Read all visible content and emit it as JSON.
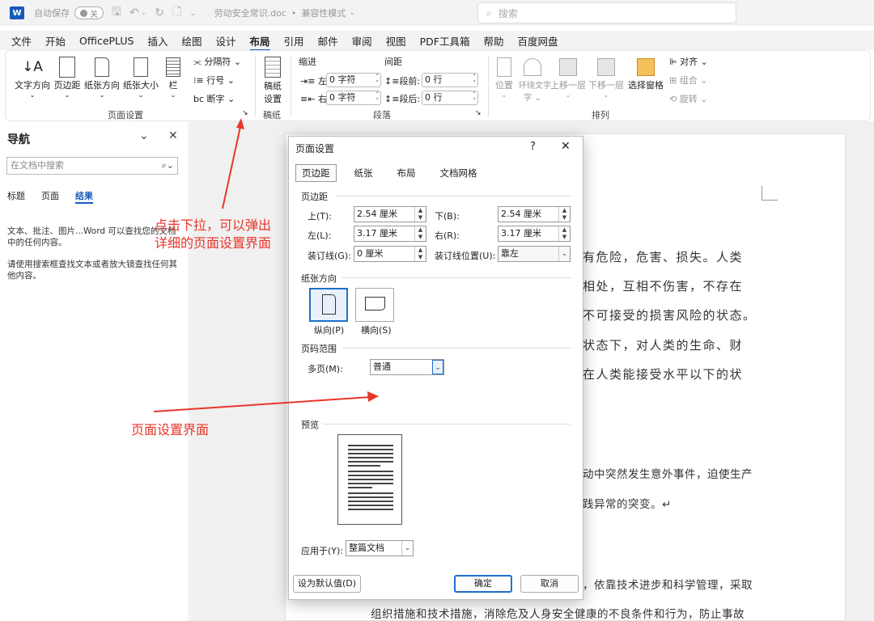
{
  "titlebar": {
    "autosave_label": "自动保存",
    "autosave_state": "关",
    "filename": "劳动安全常识.doc",
    "mode": "兼容性模式",
    "search_placeholder": "搜索"
  },
  "menu": [
    "文件",
    "开始",
    "OfficePLUS",
    "插入",
    "绘图",
    "设计",
    "布局",
    "引用",
    "邮件",
    "审阅",
    "视图",
    "PDF工具箱",
    "帮助",
    "百度网盘"
  ],
  "menu_active": "布局",
  "ribbon": {
    "page_setup": {
      "buttons": [
        "文字方向",
        "页边距",
        "纸张方向",
        "纸张大小",
        "栏"
      ],
      "side": [
        "分隔符",
        "行号",
        "断字"
      ],
      "group": "页面设置"
    },
    "draft": {
      "button_line1": "稿纸",
      "button_line2": "设置",
      "group": "稿纸"
    },
    "paragraph": {
      "indent_label": "缩进",
      "spacing_label": "间距",
      "left_label": "左:",
      "left_value": "0 字符",
      "right_label": "右:",
      "right_value": "0 字符",
      "before_label": "段前:",
      "before_value": "0 行",
      "after_label": "段后:",
      "after_value": "0 行",
      "group": "段落"
    },
    "arrange": {
      "buttons": [
        "位置",
        "环绕文字",
        "上移一层",
        "下移一层",
        "选择窗格"
      ],
      "side": [
        "对齐",
        "组合",
        "旋转"
      ],
      "group": "排列"
    }
  },
  "nav": {
    "title": "导航",
    "search_placeholder": "在文档中搜索",
    "tabs": [
      "标题",
      "页面",
      "结果"
    ],
    "tab_active": "结果",
    "text1": "文本、批注、图片...Word 可以查找您的文档中的任何内容。",
    "text2": "请使用搜索框查找文本或者放大镜查找任何其他内容。"
  },
  "document": {
    "lines": [
      "有危险，危害、损失。人类",
      "相处，互相不伤害，不存在",
      "不可接受的损害风险的状态。",
      "状态下，对人类的生命、财",
      "在人类能接受水平以下的状",
      "动中突然发生意外事件，迫使生产",
      "践异常的突变。↵",
      "，依靠技术进步和科学管理，采取",
      "组织措施和技术措施，消除危及人身安全健康的不良条件和行为，防止事故"
    ]
  },
  "dialog": {
    "title": "页面设置",
    "help": "?",
    "close": "✕",
    "tabs": [
      "页边距",
      "纸张",
      "布局",
      "文档网格"
    ],
    "tab_active": "页边距",
    "margins_section": "页边距",
    "top_label": "上(T):",
    "top_value": "2.54 厘米",
    "bottom_label": "下(B):",
    "bottom_value": "2.54 厘米",
    "left_label": "左(L):",
    "left_value": "3.17 厘米",
    "right_label": "右(R):",
    "right_value": "3.17 厘米",
    "gutter_label": "装订线(G):",
    "gutter_value": "0 厘米",
    "gutter_pos_label": "装订线位置(U):",
    "gutter_pos_value": "靠左",
    "orientation_section": "纸张方向",
    "portrait": "纵向(P)",
    "landscape": "横向(S)",
    "pages_section": "页码范围",
    "multiple_label": "多页(M):",
    "multiple_value": "普通",
    "preview_section": "预览",
    "apply_label": "应用于(Y):",
    "apply_value": "整篇文档",
    "default_btn": "设为默认值(D)",
    "ok_btn": "确定",
    "cancel_btn": "取消"
  },
  "annotations": {
    "a1_line1": "点击下拉，可以弹出",
    "a1_line2": "详细的页面设置界面",
    "a2": "页面设置界面"
  },
  "colors": {
    "accent": "#185abd",
    "annotation": "#e8362a"
  }
}
